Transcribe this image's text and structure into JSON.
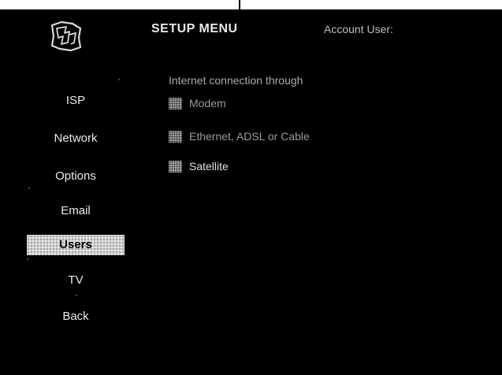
{
  "header": {
    "logo_icon": "wizard-logo-icon",
    "title": "SETUP MENU",
    "account_label": "Account User:"
  },
  "sidebar": {
    "items": [
      {
        "label": "ISP",
        "selected": false
      },
      {
        "label": "Network",
        "selected": false
      },
      {
        "label": "Options",
        "selected": false
      },
      {
        "label": "Email",
        "selected": false
      },
      {
        "label": "Users",
        "selected": true
      },
      {
        "label": "TV",
        "selected": false
      },
      {
        "label": "Back",
        "selected": false
      }
    ]
  },
  "content": {
    "prompt": "Internet connection through",
    "options": [
      {
        "label": "Modem",
        "icon": "checkbox-icon"
      },
      {
        "label": "Ethernet, ADSL or Cable",
        "icon": "checkbox-icon"
      },
      {
        "label": "Satellite",
        "icon": "checkbox-icon"
      }
    ]
  },
  "colors": {
    "background": "#000000",
    "text": "#e8e8e8",
    "dim_text": "#a9a9a9",
    "selection": "#cfcfcf"
  }
}
